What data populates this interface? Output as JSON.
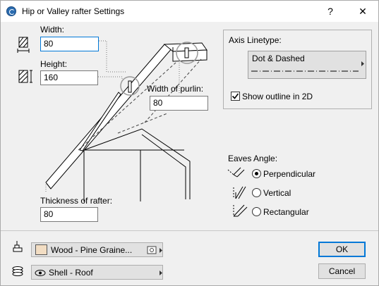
{
  "window": {
    "title": "Hip or Valley rafter Settings",
    "help_glyph": "?",
    "close_glyph": "✕"
  },
  "rafter": {
    "width_label": "Width:",
    "width_value": "80",
    "height_label": "Height:",
    "height_value": "160",
    "purlin_label": "Width of purlin:",
    "purlin_value": "80",
    "thickness_label": "Thickness of rafter:",
    "thickness_value": "80"
  },
  "axis": {
    "group_label": "Axis Linetype:",
    "linetype_value": "Dot & Dashed",
    "show_outline_label": "Show outline in 2D",
    "show_outline_checked": true
  },
  "eaves": {
    "label": "Eaves Angle:",
    "options": [
      "Perpendicular",
      "Vertical",
      "Rectangular"
    ],
    "selected": "Perpendicular"
  },
  "footer": {
    "material_value": "Wood - Pine Graine...",
    "material_swatch": "#f2ddc3",
    "layer_value": "Shell - Roof",
    "ok_label": "OK",
    "cancel_label": "Cancel"
  }
}
